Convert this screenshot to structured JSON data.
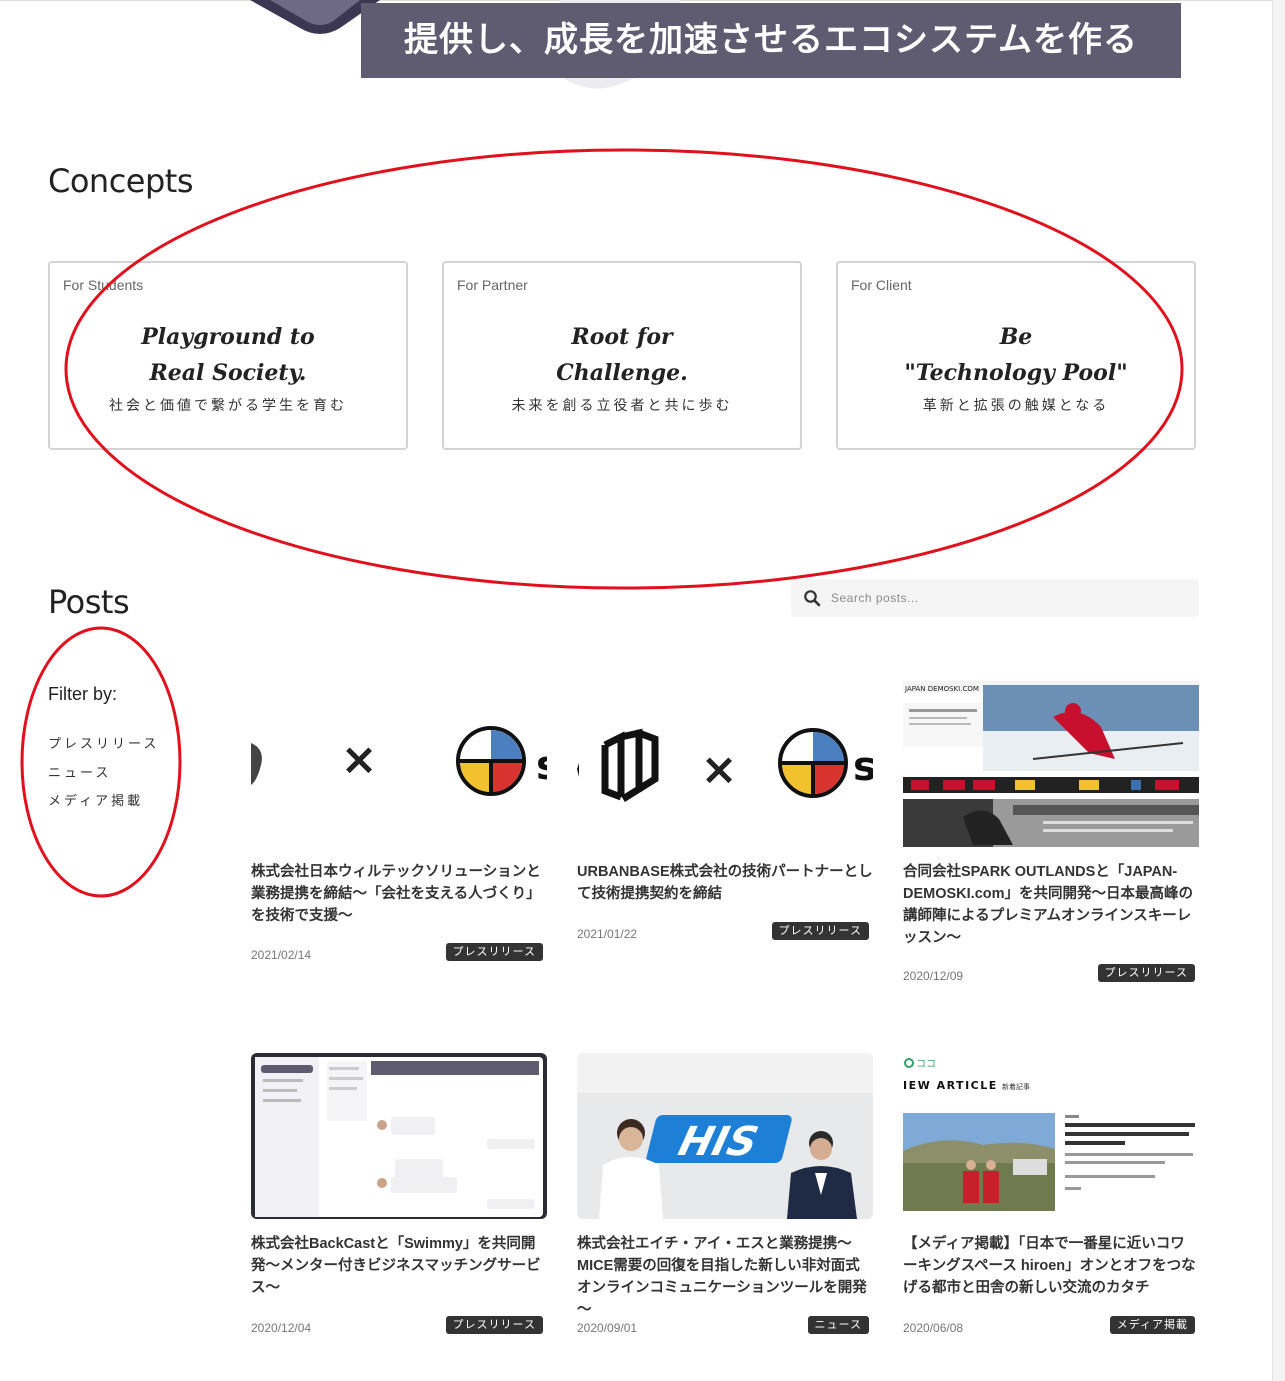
{
  "hero": {
    "banner_text": "提供し、成長を加速させるエコシステムを作る"
  },
  "concepts": {
    "title": "Concepts",
    "cards": [
      {
        "tag": "For Students",
        "script": "Playground to\nReal Society.",
        "subtitle": "社会と価値で繋がる学生を育む"
      },
      {
        "tag": "For Partner",
        "script": "Root for\nChallenge.",
        "subtitle": "未来を創る立役者と共に歩む"
      },
      {
        "tag": "For Client",
        "script": "Be\n\"Technology Pool\"",
        "subtitle": "革新と拡張の触媒となる"
      }
    ]
  },
  "posts": {
    "title": "Posts",
    "search": {
      "placeholder": "Search posts..."
    },
    "filter": {
      "title": "Filter by:",
      "items": [
        "プレスリリース",
        "ニュース",
        "メディア掲載"
      ]
    },
    "items": [
      {
        "title": "株式会社日本ウィルテックソリューションと業務提携を締結～「会社を支える人づくり」を技術で支援～",
        "date": "2021/02/14",
        "category": "プレスリリース"
      },
      {
        "title": "URBANBASE株式会社の技術パートナーとして技術提携契約を締結",
        "date": "2021/01/22",
        "category": "プレスリリース"
      },
      {
        "title": "合同会社SPARK OUTLANDSと「JAPAN-DEMOSKI.com」を共同開発～日本最高峰の講師陣によるプレミアムオンラインスキーレッスン～",
        "date": "2020/12/09",
        "category": "プレスリリース"
      },
      {
        "title": "株式会社BackCastと「Swimmy」を共同開発～メンター付きビジネスマッチングサービス～",
        "date": "2020/12/04",
        "category": "プレスリリース"
      },
      {
        "title": "株式会社エイチ・アイ・エスと業務提携～MICE需要の回復を目指した新しい非対面式オンラインコミュニケーションツールを開発～",
        "date": "2020/09/01",
        "category": "ニュース"
      },
      {
        "title": "【メディア掲載】「日本で一番星に近いコワーキングスペース hiroen」オンとオフをつなげる都市と田舎の新しい交流のカタチ",
        "date": "2020/06/08",
        "category": "メディア掲載"
      }
    ],
    "thumb_text": {
      "cross": "×",
      "his_logo": "HIS",
      "demoski_header": "JAPAN DEMOSKI.COM",
      "koko_brand": "ココ",
      "new_article": "IEW ARTICLE",
      "new_article_jp": "新着記事"
    }
  },
  "colors": {
    "banner_bg": "#5f5c72",
    "badge_bg": "#333333",
    "annotation_red": "#e0101c"
  }
}
